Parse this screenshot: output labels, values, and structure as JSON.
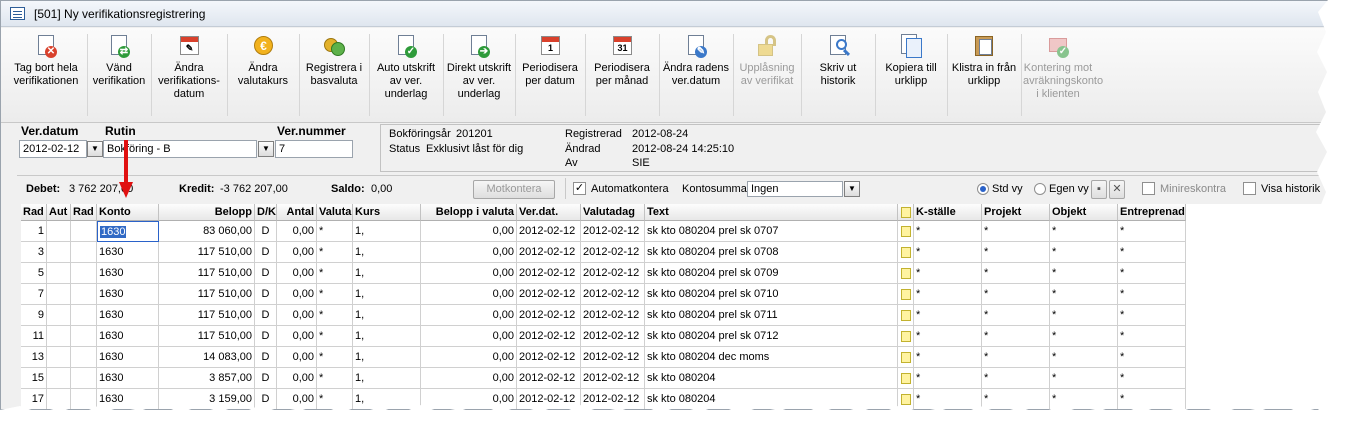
{
  "window": {
    "title": "[501]  Ny verifikationsregistrering"
  },
  "toolbar": {
    "buttons": [
      {
        "label": "Tag bort hela verifikationen",
        "icon": "delete-document-icon",
        "enabled": true
      },
      {
        "label": "Vänd verifikation",
        "icon": "reverse-arrows-icon",
        "enabled": true
      },
      {
        "label": "Ändra verifikations-datum",
        "icon": "calendar-edit-icon",
        "enabled": true
      },
      {
        "label": "Ändra valutakurs",
        "icon": "currency-icon",
        "enabled": true
      },
      {
        "label": "Registrera i basvaluta",
        "icon": "coins-icon",
        "enabled": true
      },
      {
        "label": "Auto utskrift av ver. underlag",
        "icon": "print-check-icon",
        "enabled": true
      },
      {
        "label": "Direkt utskrift av ver. underlag",
        "icon": "print-arrow-icon",
        "enabled": true
      },
      {
        "label": "Periodisera per datum",
        "icon": "calendar-day-icon",
        "enabled": true
      },
      {
        "label": "Periodisera per månad",
        "icon": "calendar-month-icon",
        "enabled": true
      },
      {
        "label": "Ändra radens ver.datum",
        "icon": "edit-document-icon",
        "enabled": true
      },
      {
        "label": "Upplåsning av verifikat",
        "icon": "unlock-icon",
        "enabled": false
      },
      {
        "label": "Skriv ut historik",
        "icon": "print-history-icon",
        "enabled": true
      },
      {
        "label": "Kopiera till urklipp",
        "icon": "copy-icon",
        "enabled": true
      },
      {
        "label": "Klistra in från urklipp",
        "icon": "paste-icon",
        "enabled": true
      },
      {
        "label": "Kontering mot avräkningskonto i klienten",
        "icon": "transfer-icon",
        "enabled": false
      }
    ],
    "calendar_day_num": "1",
    "calendar_month_num": "31"
  },
  "header": {
    "verdatum_label": "Ver.datum",
    "verdatum_value": "2012-02-12",
    "rutin_label": "Rutin",
    "rutin_value": "Bokföring - B",
    "vernummer_label": "Ver.nummer",
    "vernummer_value": "7"
  },
  "info": {
    "bokforingsar_label": "Bokföringsår",
    "bokforingsar_value": "201201",
    "status_label": "Status",
    "status_value": "Exklusivt låst för dig",
    "registrerad_label": "Registrerad",
    "registrerad_value": "2012-08-24",
    "andrad_label": "Ändrad",
    "andrad_value": "2012-08-24 14:25:10",
    "av_label": "Av",
    "av_value": "SIE"
  },
  "summary": {
    "debet_label": "Debet:",
    "debet_value": "3 762 207,00",
    "kredit_label": "Kredit:",
    "kredit_value": "-3 762 207,00",
    "saldo_label": "Saldo:",
    "saldo_value": "0,00",
    "motkontera_label": "Motkontera",
    "automatkontera_label": "Automatkontera",
    "automatkontera_checked": true,
    "kontosumma_label": "Kontosumma",
    "kontosumma_value": "Ingen",
    "stdvy_label": "Std vy",
    "egenvy_label": "Egen vy",
    "minireskontra_label": "Minireskontra",
    "visahistorik_label": "Visa historik"
  },
  "grid": {
    "columns": [
      "Rad",
      "Aut",
      "Rad",
      "Konto",
      "Belopp",
      "D/K",
      "Antal",
      "Valuta",
      "Kurs",
      "Belopp i valuta",
      "Ver.dat.",
      "Valutadag",
      "Text",
      "",
      "K-ställe",
      "Projekt",
      "Objekt",
      "Entreprenad"
    ],
    "rows": [
      {
        "rad": "1",
        "konto": "1630",
        "belopp": "83 060,00",
        "dk": "D",
        "antal": "0,00",
        "valuta": "*",
        "kurs": "1,",
        "belopp_valuta": "0,00",
        "verdat": "2012-02-12",
        "valutadag": "2012-02-12",
        "text": "sk kto 080204 prel sk 0707",
        "kstalle": "*",
        "projekt": "*",
        "objekt": "*",
        "entreprenad": "*"
      },
      {
        "rad": "3",
        "konto": "1630",
        "belopp": "117 510,00",
        "dk": "D",
        "antal": "0,00",
        "valuta": "*",
        "kurs": "1,",
        "belopp_valuta": "0,00",
        "verdat": "2012-02-12",
        "valutadag": "2012-02-12",
        "text": "sk kto 080204 prel sk 0708",
        "kstalle": "*",
        "projekt": "*",
        "objekt": "*",
        "entreprenad": "*"
      },
      {
        "rad": "5",
        "konto": "1630",
        "belopp": "117 510,00",
        "dk": "D",
        "antal": "0,00",
        "valuta": "*",
        "kurs": "1,",
        "belopp_valuta": "0,00",
        "verdat": "2012-02-12",
        "valutadag": "2012-02-12",
        "text": "sk kto 080204 prel sk 0709",
        "kstalle": "*",
        "projekt": "*",
        "objekt": "*",
        "entreprenad": "*"
      },
      {
        "rad": "7",
        "konto": "1630",
        "belopp": "117 510,00",
        "dk": "D",
        "antal": "0,00",
        "valuta": "*",
        "kurs": "1,",
        "belopp_valuta": "0,00",
        "verdat": "2012-02-12",
        "valutadag": "2012-02-12",
        "text": "sk kto 080204 prel sk 0710",
        "kstalle": "*",
        "projekt": "*",
        "objekt": "*",
        "entreprenad": "*"
      },
      {
        "rad": "9",
        "konto": "1630",
        "belopp": "117 510,00",
        "dk": "D",
        "antal": "0,00",
        "valuta": "*",
        "kurs": "1,",
        "belopp_valuta": "0,00",
        "verdat": "2012-02-12",
        "valutadag": "2012-02-12",
        "text": "sk kto 080204 prel sk 0711",
        "kstalle": "*",
        "projekt": "*",
        "objekt": "*",
        "entreprenad": "*"
      },
      {
        "rad": "11",
        "konto": "1630",
        "belopp": "117 510,00",
        "dk": "D",
        "antal": "0,00",
        "valuta": "*",
        "kurs": "1,",
        "belopp_valuta": "0,00",
        "verdat": "2012-02-12",
        "valutadag": "2012-02-12",
        "text": "sk kto 080204 prel sk 0712",
        "kstalle": "*",
        "projekt": "*",
        "objekt": "*",
        "entreprenad": "*"
      },
      {
        "rad": "13",
        "konto": "1630",
        "belopp": "14 083,00",
        "dk": "D",
        "antal": "0,00",
        "valuta": "*",
        "kurs": "1,",
        "belopp_valuta": "0,00",
        "verdat": "2012-02-12",
        "valutadag": "2012-02-12",
        "text": "sk kto 080204 dec moms",
        "kstalle": "*",
        "projekt": "*",
        "objekt": "*",
        "entreprenad": "*"
      },
      {
        "rad": "15",
        "konto": "1630",
        "belopp": "3 857,00",
        "dk": "D",
        "antal": "0,00",
        "valuta": "*",
        "kurs": "1,",
        "belopp_valuta": "0,00",
        "verdat": "2012-02-12",
        "valutadag": "2012-02-12",
        "text": "sk kto 080204",
        "kstalle": "*",
        "projekt": "*",
        "objekt": "*",
        "entreprenad": "*"
      },
      {
        "rad": "17",
        "konto": "1630",
        "belopp": "3 159,00",
        "dk": "D",
        "antal": "0,00",
        "valuta": "*",
        "kurs": "1,",
        "belopp_valuta": "0,00",
        "verdat": "2012-02-12",
        "valutadag": "2012-02-12",
        "text": "sk kto 080204",
        "kstalle": "*",
        "projekt": "*",
        "objekt": "*",
        "entreprenad": "*"
      }
    ]
  },
  "colors": {
    "arrow": "#e01010",
    "selection": "#316ac5"
  }
}
